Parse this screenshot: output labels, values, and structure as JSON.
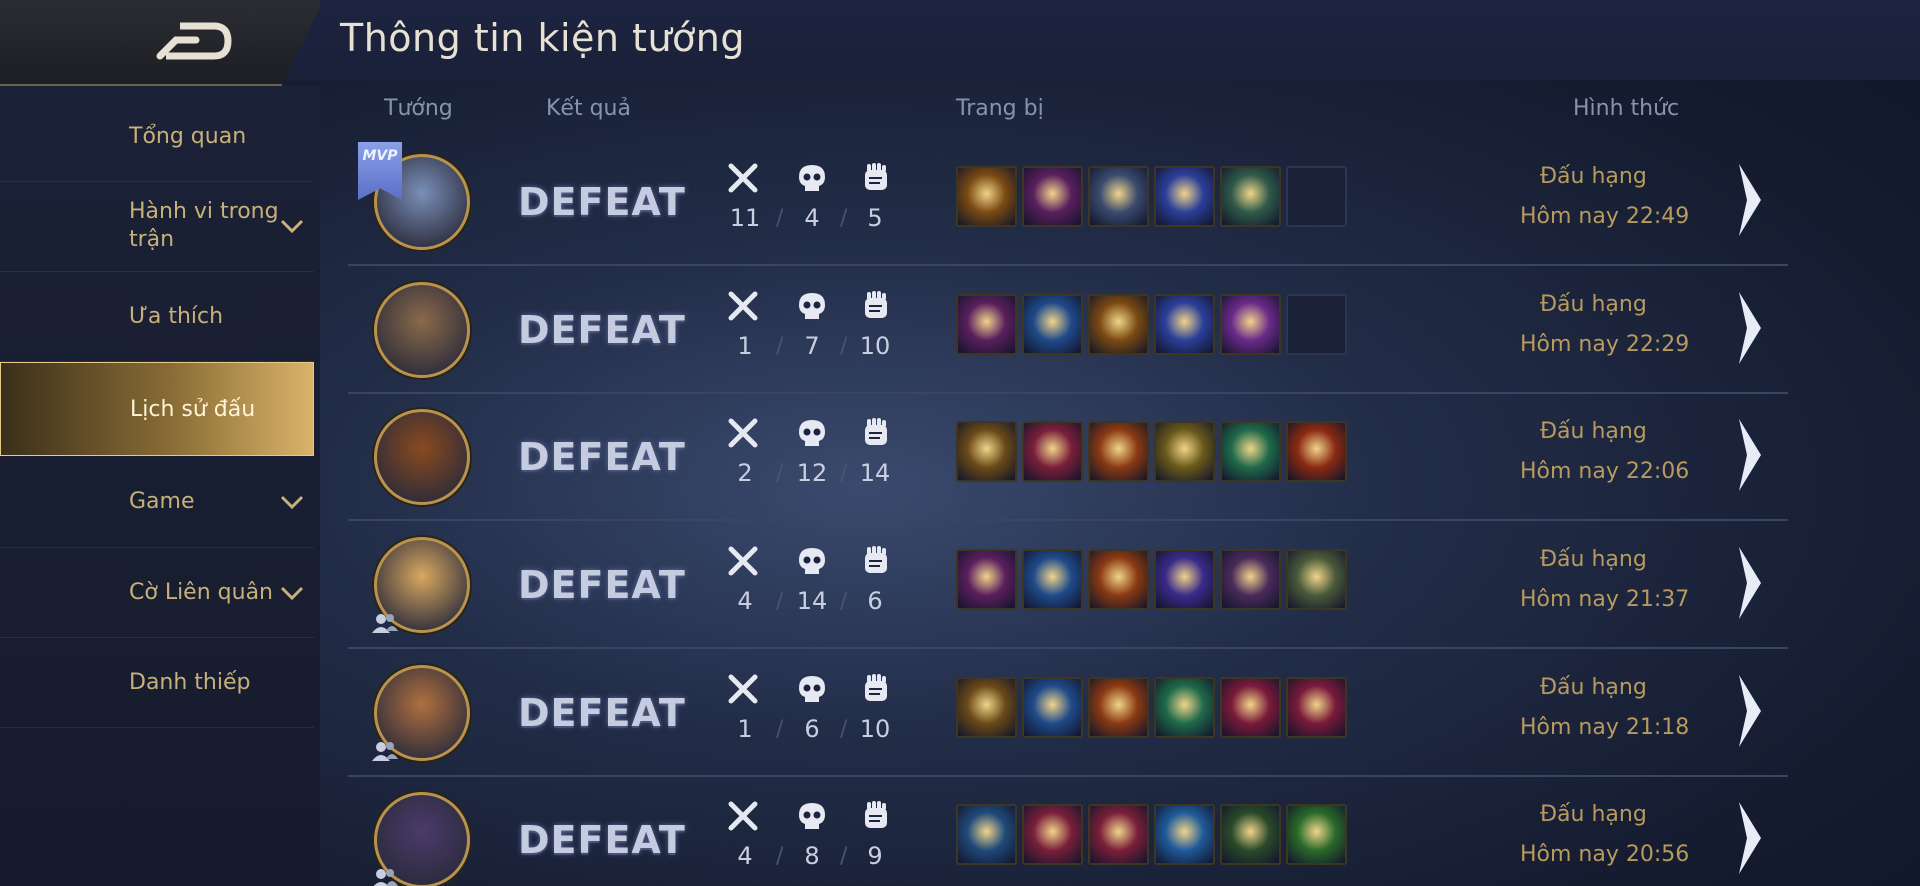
{
  "header": {
    "title": "Thông tin kiện tướng"
  },
  "sidebar": {
    "items": [
      {
        "label": "Tổng quan",
        "expandable": false,
        "active": false
      },
      {
        "label": "Hành vi trong trận",
        "expandable": true,
        "active": false
      },
      {
        "label": "Ưa thích",
        "expandable": false,
        "active": false
      },
      {
        "label": "Lịch sử đấu",
        "expandable": false,
        "active": true
      },
      {
        "label": "Game",
        "expandable": true,
        "active": false
      },
      {
        "label": "Cờ Liên quân",
        "expandable": true,
        "active": false
      },
      {
        "label": "Danh thiếp",
        "expandable": false,
        "active": false
      }
    ]
  },
  "columns": {
    "hero": "Tướng",
    "result": "Kết quả",
    "items": "Trang bị",
    "mode": "Hình thức"
  },
  "colors": {
    "accent": "#c7b079",
    "active_bg": "#d9b36a",
    "text_value": "#c9cfe0",
    "mode_text": "#b89a5e"
  },
  "matches": [
    {
      "hero_icon": "hero-portrait-1",
      "mvp": true,
      "mvp_label": "MVP",
      "party": false,
      "result": "DEFEAT",
      "kills": "11",
      "deaths": "4",
      "assists": "5",
      "items": [
        "#7a4a12",
        "#5a1f5e",
        "#3a4a6e",
        "#2b3f9a",
        "#2f5a4a",
        "empty"
      ],
      "mode": "Đấu hạng",
      "time": "Hôm nay 22:49"
    },
    {
      "hero_icon": "hero-portrait-2",
      "mvp": false,
      "party": false,
      "result": "DEFEAT",
      "kills": "1",
      "deaths": "7",
      "assists": "10",
      "items": [
        "#5a1f5e",
        "#1f4a8a",
        "#7a4a12",
        "#2b3f9a",
        "#6a2a8a",
        "empty"
      ],
      "mode": "Đấu hạng",
      "time": "Hôm nay 22:29"
    },
    {
      "hero_icon": "hero-portrait-3",
      "mvp": false,
      "party": false,
      "result": "DEFEAT",
      "kills": "2",
      "deaths": "12",
      "assists": "14",
      "items": [
        "#6a4a18",
        "#7a1f3a",
        "#8a3a12",
        "#6a5a1a",
        "#1f6a4a",
        "#8a2a12"
      ],
      "mode": "Đấu hạng",
      "time": "Hôm nay 22:06"
    },
    {
      "hero_icon": "hero-portrait-4",
      "mvp": false,
      "party": true,
      "result": "DEFEAT",
      "kills": "4",
      "deaths": "14",
      "assists": "6",
      "items": [
        "#5a1f5e",
        "#1f4a8a",
        "#8a3a12",
        "#3a2a8a",
        "#4a2a5a",
        "#4a5a3a"
      ],
      "mode": "Đấu hạng",
      "time": "Hôm nay 21:37"
    },
    {
      "hero_icon": "hero-portrait-5",
      "mvp": false,
      "party": true,
      "result": "DEFEAT",
      "kills": "1",
      "deaths": "6",
      "assists": "10",
      "items": [
        "#6a4a18",
        "#1f4a8a",
        "#8a3a12",
        "#1f6a4a",
        "#7a1a3a",
        "#7a1a3a"
      ],
      "mode": "Đấu hạng",
      "time": "Hôm nay 21:18"
    },
    {
      "hero_icon": "hero-portrait-6",
      "mvp": false,
      "party": true,
      "result": "DEFEAT",
      "kills": "4",
      "deaths": "8",
      "assists": "9",
      "items": [
        "#1f4a7a",
        "#7a1f3a",
        "#7a1f3a",
        "#1f5a9a",
        "#2a4a2a",
        "#2a6a2a"
      ],
      "mode": "Đấu hạng",
      "time": "Hôm nay 20:56"
    }
  ]
}
